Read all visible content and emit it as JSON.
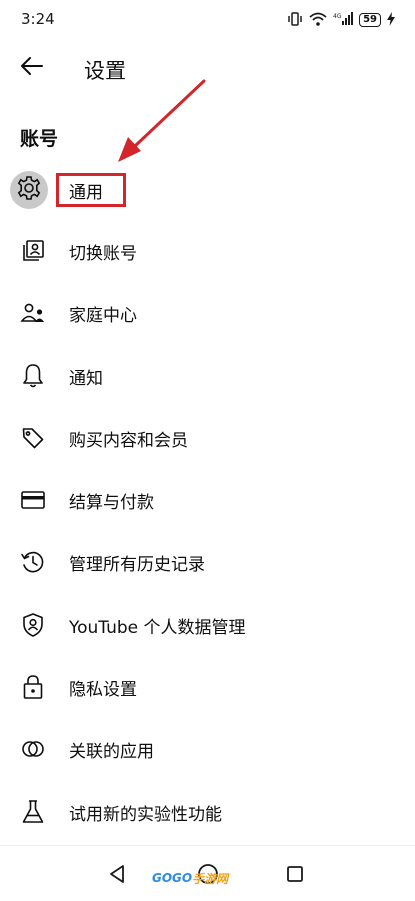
{
  "status_bar": {
    "time": "3:24",
    "battery": "59",
    "icons": [
      "vibrate-icon",
      "wifi-icon",
      "4g-signal-icon",
      "battery-icon",
      "charging-icon"
    ]
  },
  "header": {
    "back_icon": "arrow-left-icon",
    "title": "设置"
  },
  "section": {
    "title": "账号"
  },
  "menu": [
    {
      "label": "通用",
      "icon": "gear-icon"
    },
    {
      "label": "切换账号",
      "icon": "switch-account-icon"
    },
    {
      "label": "家庭中心",
      "icon": "family-icon"
    },
    {
      "label": "通知",
      "icon": "bell-icon"
    },
    {
      "label": "购买内容和会员",
      "icon": "tag-icon"
    },
    {
      "label": "结算与付款",
      "icon": "credit-card-icon"
    },
    {
      "label": "管理所有历史记录",
      "icon": "history-icon"
    },
    {
      "label": "YouTube 个人数据管理",
      "icon": "shield-person-icon"
    },
    {
      "label": "隐私设置",
      "icon": "lock-icon"
    },
    {
      "label": "关联的应用",
      "icon": "linked-apps-icon"
    },
    {
      "label": "试用新的实验性功能",
      "icon": "flask-icon"
    }
  ],
  "annotation": {
    "highlight_color": "#d2262b"
  },
  "nav_bar": {
    "icons": [
      "back-triangle-icon",
      "home-circle-icon",
      "recents-square-icon"
    ]
  },
  "watermark": {
    "text_main": "GOGO",
    "text_accent": "手游网"
  }
}
